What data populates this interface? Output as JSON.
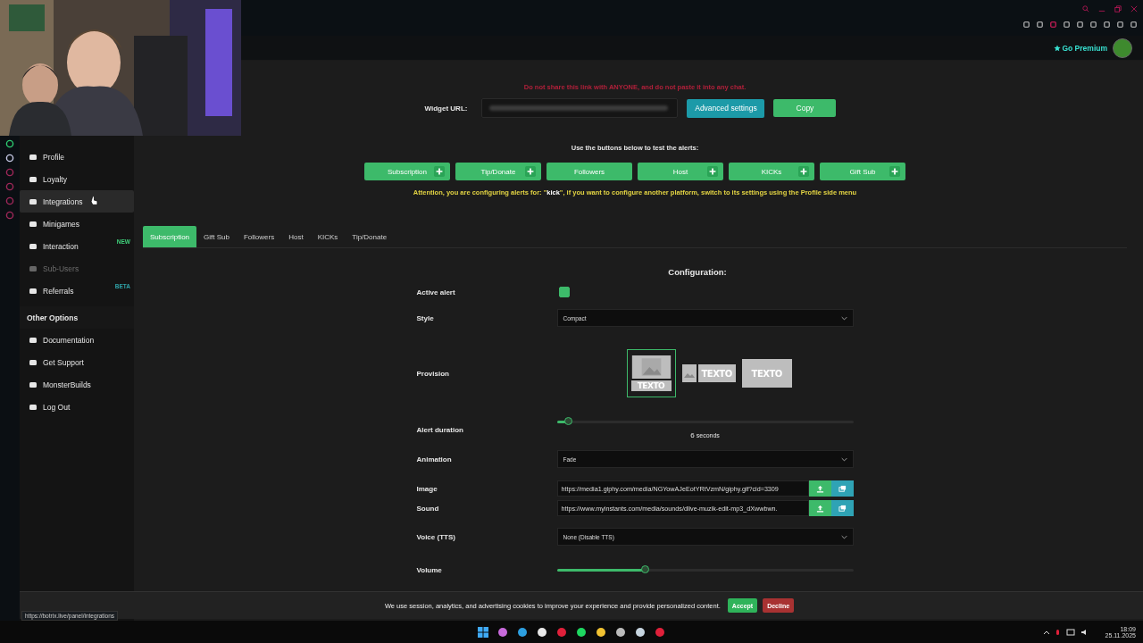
{
  "header": {
    "premium_link": "Go Premium"
  },
  "sidebar": {
    "items": [
      {
        "label": "Profile",
        "highlighted": false,
        "disabled": false
      },
      {
        "label": "Loyalty",
        "highlighted": false,
        "disabled": false
      },
      {
        "label": "Integrations",
        "highlighted": true,
        "disabled": false
      },
      {
        "label": "Minigames",
        "highlighted": false,
        "disabled": false
      },
      {
        "label": "Interaction",
        "highlighted": false,
        "disabled": false,
        "badge": "NEW",
        "color": "#3fd07a"
      },
      {
        "label": "Sub-Users",
        "highlighted": false,
        "disabled": true
      },
      {
        "label": "Referrals",
        "highlighted": false,
        "disabled": false,
        "badge": "BETA",
        "color": "#2fa3a8"
      }
    ],
    "section_title": "Other Options",
    "other_items": [
      {
        "label": "Documentation"
      },
      {
        "label": "Get Support"
      },
      {
        "label": "MonsterBuilds"
      },
      {
        "label": "Log Out"
      }
    ]
  },
  "widget": {
    "warning": "Do not share this link with ANYONE, and do not paste it into any chat.",
    "label": "Widget URL:",
    "advanced_button": "Advanced settings",
    "copy_button": "Copy"
  },
  "test": {
    "instruction": "Use the buttons below to test the alerts:",
    "buttons": [
      {
        "label": "Subscription",
        "add": true
      },
      {
        "label": "Tip/Donate",
        "add": true
      },
      {
        "label": "Followers",
        "add": false
      },
      {
        "label": "Host",
        "add": true
      },
      {
        "label": "KICKs",
        "add": true
      },
      {
        "label": "Gift Sub",
        "add": true
      }
    ],
    "attention": "Attention, you are configuring alerts for: \"**kick**\", if you want to configure another platform, switch to its settings using the Profile side menu"
  },
  "tabs": [
    {
      "label": "Subscription",
      "selected": true
    },
    {
      "label": "Gift Sub",
      "selected": false
    },
    {
      "label": "Followers",
      "selected": false
    },
    {
      "label": "Host",
      "selected": false
    },
    {
      "label": "KICKs",
      "selected": false
    },
    {
      "label": "Tip/Donate",
      "selected": false
    }
  ],
  "config": {
    "title": "Configuration:",
    "rows": [
      {
        "kind": "checkbox",
        "label": "Active alert",
        "checked": true
      },
      {
        "kind": "select",
        "label": "Style",
        "value": "Compact"
      },
      {
        "kind": "provision",
        "label": "Provision",
        "options": [
          {
            "kind": "stacked",
            "text": "TEXTO",
            "selected": true
          },
          {
            "kind": "inline",
            "text": "TEXTO",
            "selected": false
          },
          {
            "kind": "overlay",
            "text": "TEXTO",
            "selected": false
          }
        ]
      },
      {
        "kind": "slider",
        "label": "Alert duration",
        "level": 0.04,
        "value": "6",
        "unit": "seconds"
      },
      {
        "kind": "select",
        "label": "Animation",
        "value": "Fade"
      },
      {
        "kind": "media",
        "label": "Image",
        "value": "https://media1.giphy.com/media/NGYowAJeEotYRtVzmN/giphy.gif?cid=3309"
      },
      {
        "kind": "media",
        "label": "Sound",
        "value": "https://www.myinstants.com/media/sounds/dlive-muzik-edit-mp3_dXwwbwn."
      },
      {
        "kind": "select",
        "label": "Voice (TTS)",
        "value": "None (Disable TTS)"
      },
      {
        "kind": "slider",
        "label": "Volume",
        "level": 0.3
      }
    ]
  },
  "cookie": {
    "message": "We use session, analytics, and advertising cookies to improve your experience and provide personalized content.",
    "accept": "Accept",
    "decline": "Decline"
  },
  "status_url": "https://botrix.live/panel/integrations",
  "taskbar": {
    "time": "18:09",
    "date": "25.11.2025"
  }
}
